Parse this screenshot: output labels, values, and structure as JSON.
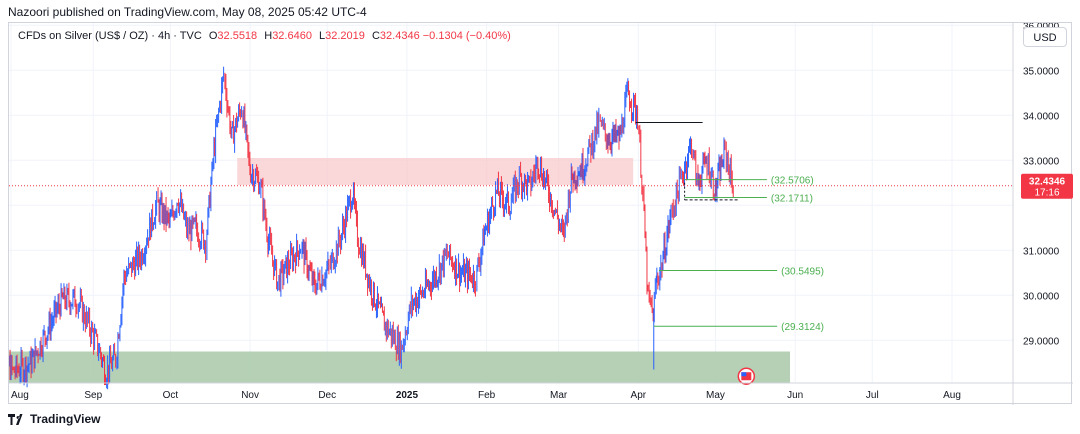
{
  "header": {
    "text": "Nazoori published on TradingView.com, May 08, 2025 05:42 UTC-4"
  },
  "legend": {
    "symbol": "CFDs on Silver (US$ / OZ) · 4h · TVC",
    "o_key": "O",
    "o_val": "32.5518",
    "h_key": "H",
    "h_val": "32.6460",
    "l_key": "L",
    "l_val": "32.2019",
    "c_key": "C",
    "c_val": "32.4346",
    "change": "−0.1304 (−0.40%)"
  },
  "currency_button": "USD",
  "footer": {
    "brand": "TradingView"
  },
  "colors": {
    "up": "#2962ff",
    "down": "#f23645",
    "zone_red": "#f8c9cc",
    "zone_green": "#a8c8a8",
    "level": "#4caf50",
    "price_tag": "#f23645"
  },
  "chart_data": {
    "type": "candlestick",
    "symbol": "CFDs on Silver (US$ / OZ)",
    "timeframe": "4h",
    "y_ticks": [
      "29.0000",
      "30.0000",
      "31.0000",
      "32.0000",
      "33.0000",
      "34.0000",
      "35.0000",
      "36.0000"
    ],
    "ylim": [
      28.05,
      36.05
    ],
    "x_ticks": [
      "Aug",
      "Sep",
      "Oct",
      "Nov",
      "Dec",
      "2025",
      "Feb",
      "Mar",
      "Apr",
      "May",
      "Jun",
      "Jul",
      "Aug"
    ],
    "current_price": {
      "value": "32.4346",
      "countdown": "17:16"
    },
    "levels": [
      {
        "label": "(32.5706)",
        "value": 32.5706
      },
      {
        "label": "(32.1711)",
        "value": 32.1711
      },
      {
        "label": "(30.5495)",
        "value": 30.5495
      },
      {
        "label": "(29.3124)",
        "value": 29.3124
      }
    ],
    "zones": [
      {
        "name": "resistance",
        "from": 32.45,
        "to": 33.05
      },
      {
        "name": "support",
        "from": 28.0,
        "to": 28.75
      }
    ],
    "path": [
      [
        "2024-07-25",
        28.9
      ],
      [
        "2024-08-01",
        28.3
      ],
      [
        "2024-08-08",
        28.5
      ],
      [
        "2024-08-15",
        29.3
      ],
      [
        "2024-08-20",
        29.9
      ],
      [
        "2024-08-26",
        29.9
      ],
      [
        "2024-08-30",
        29.4
      ],
      [
        "2024-09-04",
        28.7
      ],
      [
        "2024-09-06",
        28.3
      ],
      [
        "2024-09-10",
        28.6
      ],
      [
        "2024-09-13",
        30.4
      ],
      [
        "2024-09-20",
        30.9
      ],
      [
        "2024-09-26",
        32.0
      ],
      [
        "2024-10-01",
        31.6
      ],
      [
        "2024-10-04",
        32.2
      ],
      [
        "2024-10-08",
        31.4
      ],
      [
        "2024-10-11",
        31.5
      ],
      [
        "2024-10-15",
        31.2
      ],
      [
        "2024-10-18",
        33.2
      ],
      [
        "2024-10-22",
        34.9
      ],
      [
        "2024-10-25",
        33.5
      ],
      [
        "2024-10-29",
        34.2
      ],
      [
        "2024-11-01",
        32.8
      ],
      [
        "2024-11-05",
        32.5
      ],
      [
        "2024-11-08",
        31.3
      ],
      [
        "2024-11-12",
        30.3
      ],
      [
        "2024-11-15",
        30.6
      ],
      [
        "2024-11-21",
        31.1
      ],
      [
        "2024-11-26",
        30.2
      ],
      [
        "2024-12-02",
        30.6
      ],
      [
        "2024-12-06",
        31.2
      ],
      [
        "2024-12-11",
        32.3
      ],
      [
        "2024-12-13",
        31.3
      ],
      [
        "2024-12-18",
        30.2
      ],
      [
        "2024-12-23",
        29.4
      ],
      [
        "2024-12-30",
        28.8
      ],
      [
        "2025-01-03",
        29.8
      ],
      [
        "2025-01-08",
        30.1
      ],
      [
        "2025-01-13",
        30.5
      ],
      [
        "2025-01-17",
        30.9
      ],
      [
        "2025-01-22",
        30.5
      ],
      [
        "2025-01-28",
        30.4
      ],
      [
        "2025-01-31",
        31.3
      ],
      [
        "2025-02-05",
        32.3
      ],
      [
        "2025-02-10",
        32.0
      ],
      [
        "2025-02-14",
        32.6
      ],
      [
        "2025-02-18",
        32.4
      ],
      [
        "2025-02-21",
        33.0
      ],
      [
        "2025-02-26",
        32.2
      ],
      [
        "2025-03-03",
        31.3
      ],
      [
        "2025-03-06",
        32.6
      ],
      [
        "2025-03-11",
        32.9
      ],
      [
        "2025-03-17",
        33.8
      ],
      [
        "2025-03-20",
        33.5
      ],
      [
        "2025-03-25",
        33.5
      ],
      [
        "2025-03-28",
        34.5
      ],
      [
        "2025-04-01",
        34.0
      ],
      [
        "2025-04-03",
        32.2
      ],
      [
        "2025-04-05",
        29.9
      ],
      [
        "2025-04-07",
        29.6
      ],
      [
        "2025-04-08",
        30.3
      ],
      [
        "2025-04-10",
        30.6
      ],
      [
        "2025-04-14",
        31.8
      ],
      [
        "2025-04-18",
        32.6
      ],
      [
        "2025-04-22",
        33.4
      ],
      [
        "2025-04-24",
        32.5
      ],
      [
        "2025-04-28",
        33.0
      ],
      [
        "2025-05-01",
        32.3
      ],
      [
        "2025-05-05",
        33.2
      ],
      [
        "2025-05-08",
        32.4
      ]
    ]
  }
}
